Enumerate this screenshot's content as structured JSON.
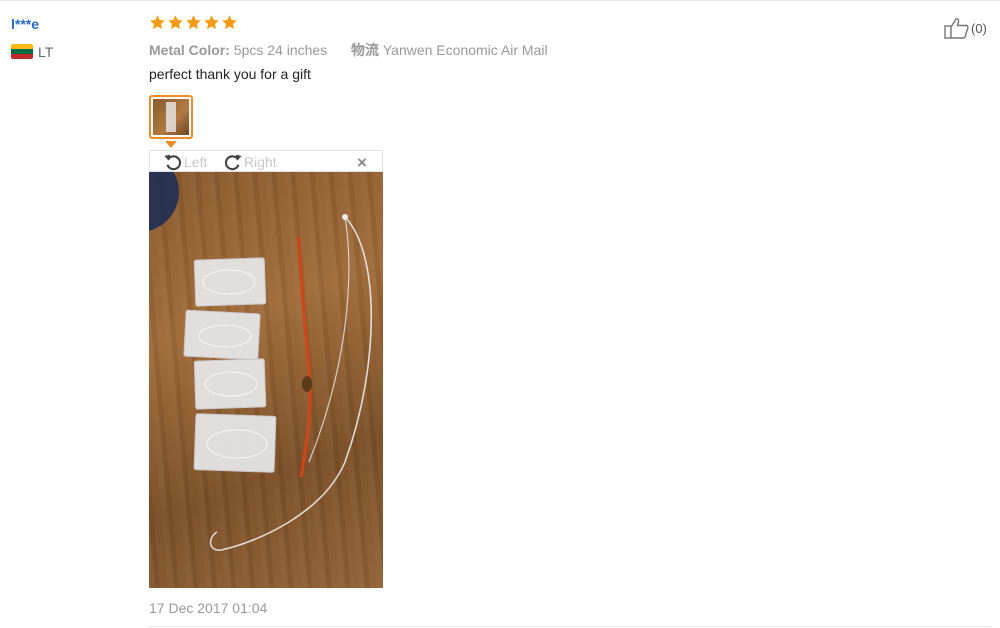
{
  "review": {
    "user_name": "l***e",
    "country_code": "LT",
    "rating": 5,
    "meta": {
      "option_label": "Metal Color:",
      "option_value": "5pcs 24 inches",
      "shipping_label": "物流",
      "shipping_value": "Yanwen Economic Air Mail"
    },
    "text": "perfect thank you for a gift",
    "date": "17 Dec 2017 01:04",
    "helpful_count": "(0)"
  },
  "viewer": {
    "rotate_left_label": "Left",
    "rotate_right_label": "Right",
    "close_label": "×"
  },
  "colors": {
    "user_link": "#2b6cc4",
    "star": "#f59a12",
    "thumb_border": "#f08a24",
    "flag": [
      "#fdb913",
      "#006a44",
      "#c1272d"
    ]
  }
}
